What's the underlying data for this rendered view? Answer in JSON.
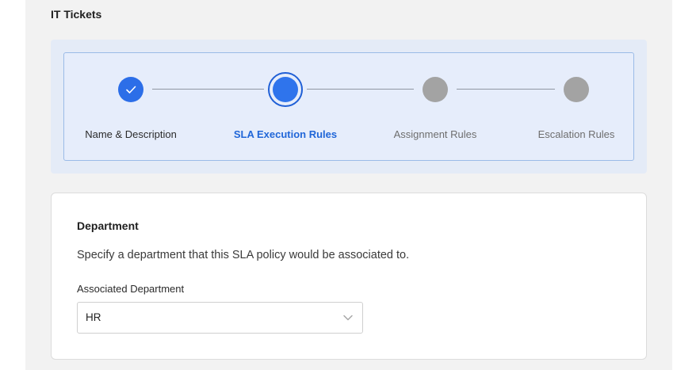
{
  "page": {
    "title": "IT Tickets"
  },
  "stepper": {
    "steps": [
      {
        "label": "Name & Description",
        "state": "completed"
      },
      {
        "label": "SLA Execution Rules",
        "state": "current"
      },
      {
        "label": "Assignment Rules",
        "state": "upcoming"
      },
      {
        "label": "Escalation Rules",
        "state": "upcoming"
      }
    ],
    "icons": {
      "completed": "check-icon"
    },
    "colors": {
      "completed": "#2c6ee8",
      "current": "#2f74ec",
      "upcoming": "#a3a3a3",
      "current_label": "#2066d8"
    }
  },
  "department_section": {
    "heading": "Department",
    "description": "Specify a department that this SLA policy would be associated to.",
    "field_label": "Associated Department",
    "selected_value": "HR",
    "dropdown_icon": "chevron-down-icon"
  }
}
